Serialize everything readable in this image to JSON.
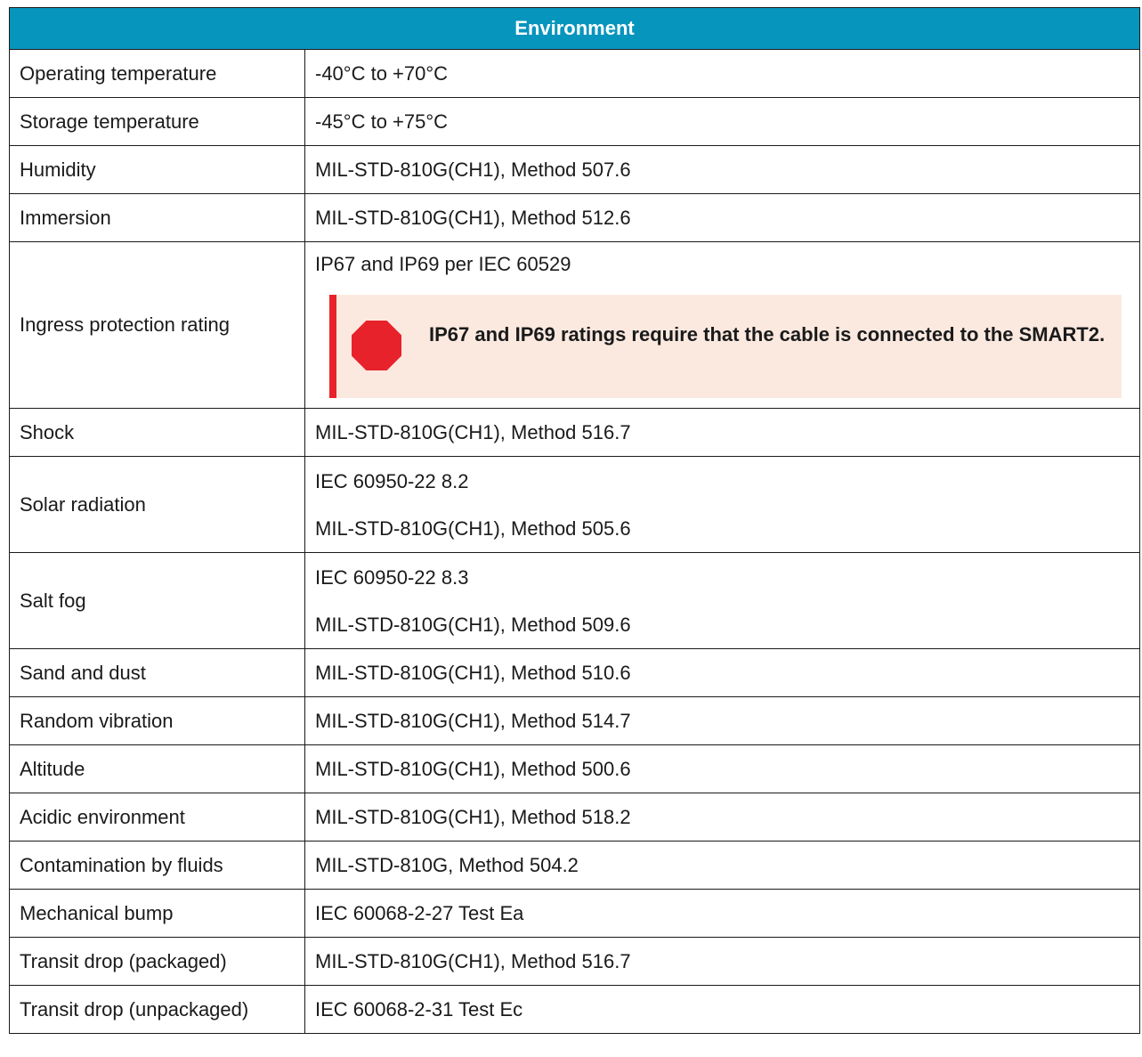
{
  "table": {
    "header": "Environment",
    "rows": [
      {
        "label": "Operating temperature",
        "value": "-40°C to +70°C"
      },
      {
        "label": "Storage temperature",
        "value": "-45°C to +75°C"
      },
      {
        "label": "Humidity",
        "value": "MIL-STD-810G(CH1), Method 507.6"
      },
      {
        "label": "Immersion",
        "value": "MIL-STD-810G(CH1), Method 512.6"
      },
      {
        "label": "Ingress protection rating",
        "value": "IP67 and IP69 per IEC 60529",
        "warning": "IP67 and IP69 ratings require that the cable is connected to the SMART2.",
        "warning_icon": "stop-icon",
        "warning_color": "#e8222b"
      },
      {
        "label": "Shock",
        "value": "MIL-STD-810G(CH1), Method 516.7"
      },
      {
        "label": "Solar radiation",
        "values": [
          "IEC 60950-22 8.2",
          "MIL-STD-810G(CH1), Method 505.6"
        ]
      },
      {
        "label": "Salt fog",
        "values": [
          "IEC 60950-22 8.3",
          "MIL-STD-810G(CH1), Method 509.6"
        ]
      },
      {
        "label": "Sand and dust",
        "value": "MIL-STD-810G(CH1), Method 510.6"
      },
      {
        "label": "Random vibration",
        "value": "MIL-STD-810G(CH1), Method 514.7"
      },
      {
        "label": "Altitude",
        "value": "MIL-STD-810G(CH1), Method 500.6"
      },
      {
        "label": "Acidic environment",
        "value": "MIL-STD-810G(CH1), Method 518.2"
      },
      {
        "label": "Contamination by fluids",
        "value": "MIL-STD-810G, Method 504.2"
      },
      {
        "label": "Mechanical bump",
        "value": "IEC 60068-2-27 Test Ea"
      },
      {
        "label": "Transit drop (packaged)",
        "value": "MIL-STD-810G(CH1), Method 516.7"
      },
      {
        "label": "Transit drop (unpackaged)",
        "value": "IEC 60068-2-31 Test Ec"
      }
    ]
  },
  "colors": {
    "header_bg": "#0695bd",
    "header_text": "#ffffff",
    "warning_bg": "#fbe9e0",
    "warning_accent": "#e8222b"
  }
}
